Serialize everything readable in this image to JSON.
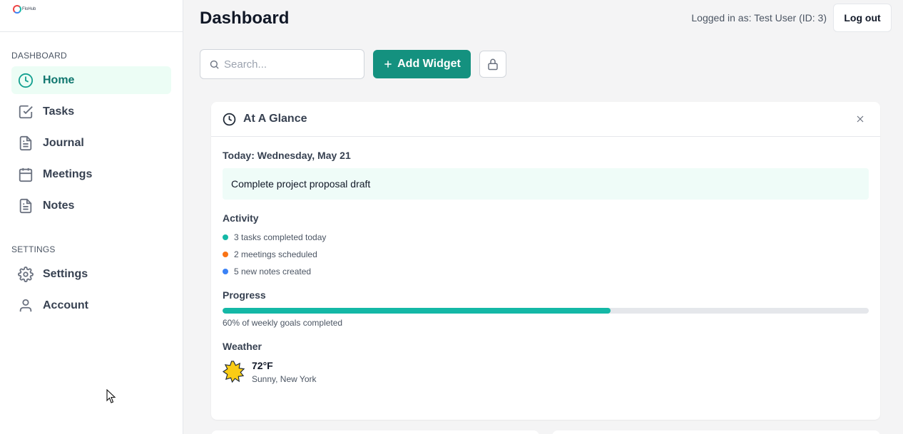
{
  "app": {
    "logo_text": "FloHub"
  },
  "sidebar": {
    "sections": [
      {
        "label": "DASHBOARD"
      },
      {
        "label": "SETTINGS"
      }
    ],
    "items": [
      {
        "label": "Home",
        "icon": "clock-icon",
        "active": true
      },
      {
        "label": "Tasks",
        "icon": "checkbox-icon"
      },
      {
        "label": "Journal",
        "icon": "document-icon"
      },
      {
        "label": "Meetings",
        "icon": "calendar-icon"
      },
      {
        "label": "Notes",
        "icon": "document-icon"
      },
      {
        "label": "Settings",
        "icon": "gear-icon"
      },
      {
        "label": "Account",
        "icon": "user-icon"
      }
    ]
  },
  "header": {
    "title": "Dashboard",
    "login_info": "Logged in as: Test User (ID: 3)",
    "logout_label": "Log out"
  },
  "toolbar": {
    "search_placeholder": "Search...",
    "search_value": "",
    "add_widget_label": "Add Widget"
  },
  "widget": {
    "title": "At A Glance",
    "today": "Today: Wednesday, May 21",
    "task": "Complete project proposal draft",
    "activity_heading": "Activity",
    "activity": [
      {
        "text": "3 tasks completed today",
        "color": "#14b8a6"
      },
      {
        "text": "2 meetings scheduled",
        "color": "#f97316"
      },
      {
        "text": "5 new notes created",
        "color": "#3b82f6"
      }
    ],
    "progress_heading": "Progress",
    "progress_percent": 60,
    "progress_text": "60% of weekly goals completed",
    "weather_heading": "Weather",
    "weather_temp": "72°F",
    "weather_desc": "Sunny, New York"
  },
  "colors": {
    "accent": "#14917f",
    "active_bg": "#ecfdf5",
    "progress": "#14b8a6"
  }
}
